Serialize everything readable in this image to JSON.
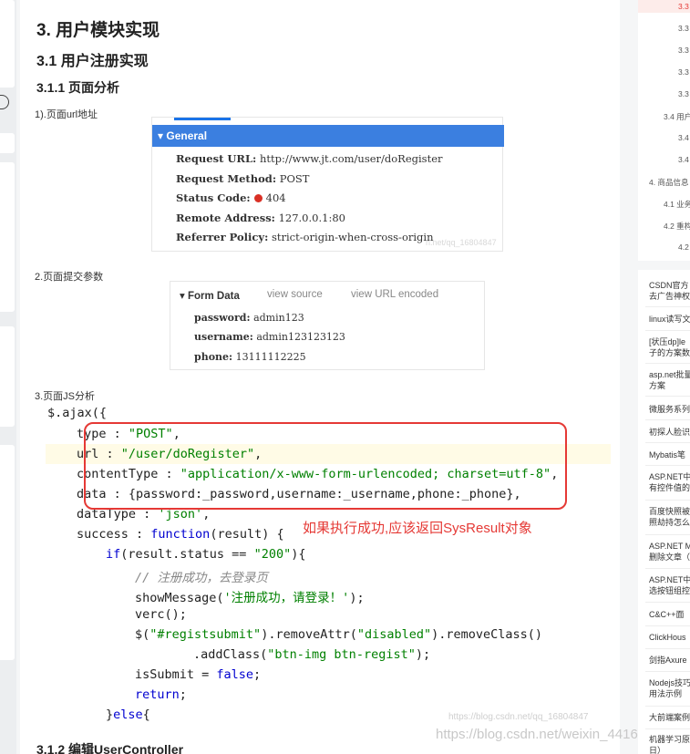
{
  "article": {
    "h2": "3. 用户模块实现",
    "h3": "3.1 用户注册实现",
    "h4": "3.1.1 页面分析",
    "note1": "1).页面url地址",
    "note2": "2.页面提交参数",
    "note3": "3.页面JS分析",
    "h4_next": "3.1.2 编辑UserController",
    "footer_watermark": "https://blog.csdn.net/weixin_4416"
  },
  "general_panel": {
    "title": "▾ General",
    "rows": [
      {
        "label": "Request URL:",
        "value": "http://www.jt.com/user/doRegister"
      },
      {
        "label": "Request Method:",
        "value": "POST"
      },
      {
        "label": "Status Code:",
        "value": "404"
      },
      {
        "label": "Remote Address:",
        "value": "127.0.0.1:80"
      },
      {
        "label": "Referrer Policy:",
        "value": "strict-origin-when-cross-origin"
      }
    ],
    "watermark": "n.net/qq_16804847",
    "status_color": "#d93025",
    "header_color": "#3b7fe0"
  },
  "form_panel": {
    "title": "▾ Form Data",
    "view_source": "view source",
    "view_url": "view URL encoded",
    "rows": [
      {
        "label": "password:",
        "value": "admin123"
      },
      {
        "label": "username:",
        "value": "admin123123123"
      },
      {
        "label": "phone:",
        "value": "13111112225"
      }
    ]
  },
  "code": {
    "annotation": "如果执行成功,应该返回SysResult对象",
    "watermark": "https://blog.csdn.net/qq_16804847",
    "annotation_color": "#e53935"
  },
  "toc": {
    "items": [
      "3.3",
      "3.3",
      "3.3",
      "3.3",
      "3.3",
      "3.4 用户",
      "3.4",
      "3.4",
      "4. 商品信息",
      "4.1 业务",
      "4.2 重构",
      "4.2"
    ]
  },
  "recommend": {
    "items": [
      "CSDN官方",
      "去广告神权",
      "linux读写文",
      "[状压dp]le",
      "子的方案数",
      "asp.net批量",
      "方案",
      "微服务系列",
      "初探人脸识",
      "Mybatis笔",
      "ASP.NET中",
      "有控件值的",
      "百度快照被",
      "照劫持怎么",
      "ASP.NET M",
      "删除文章（",
      "ASP.NET中",
      "选按钮组控",
      "C&C++面",
      "ClickHous",
      "剑指Axure",
      "Nodejs技巧",
      "用法示例",
      "大前端案例",
      "机器学习原",
      "日）"
    ]
  }
}
